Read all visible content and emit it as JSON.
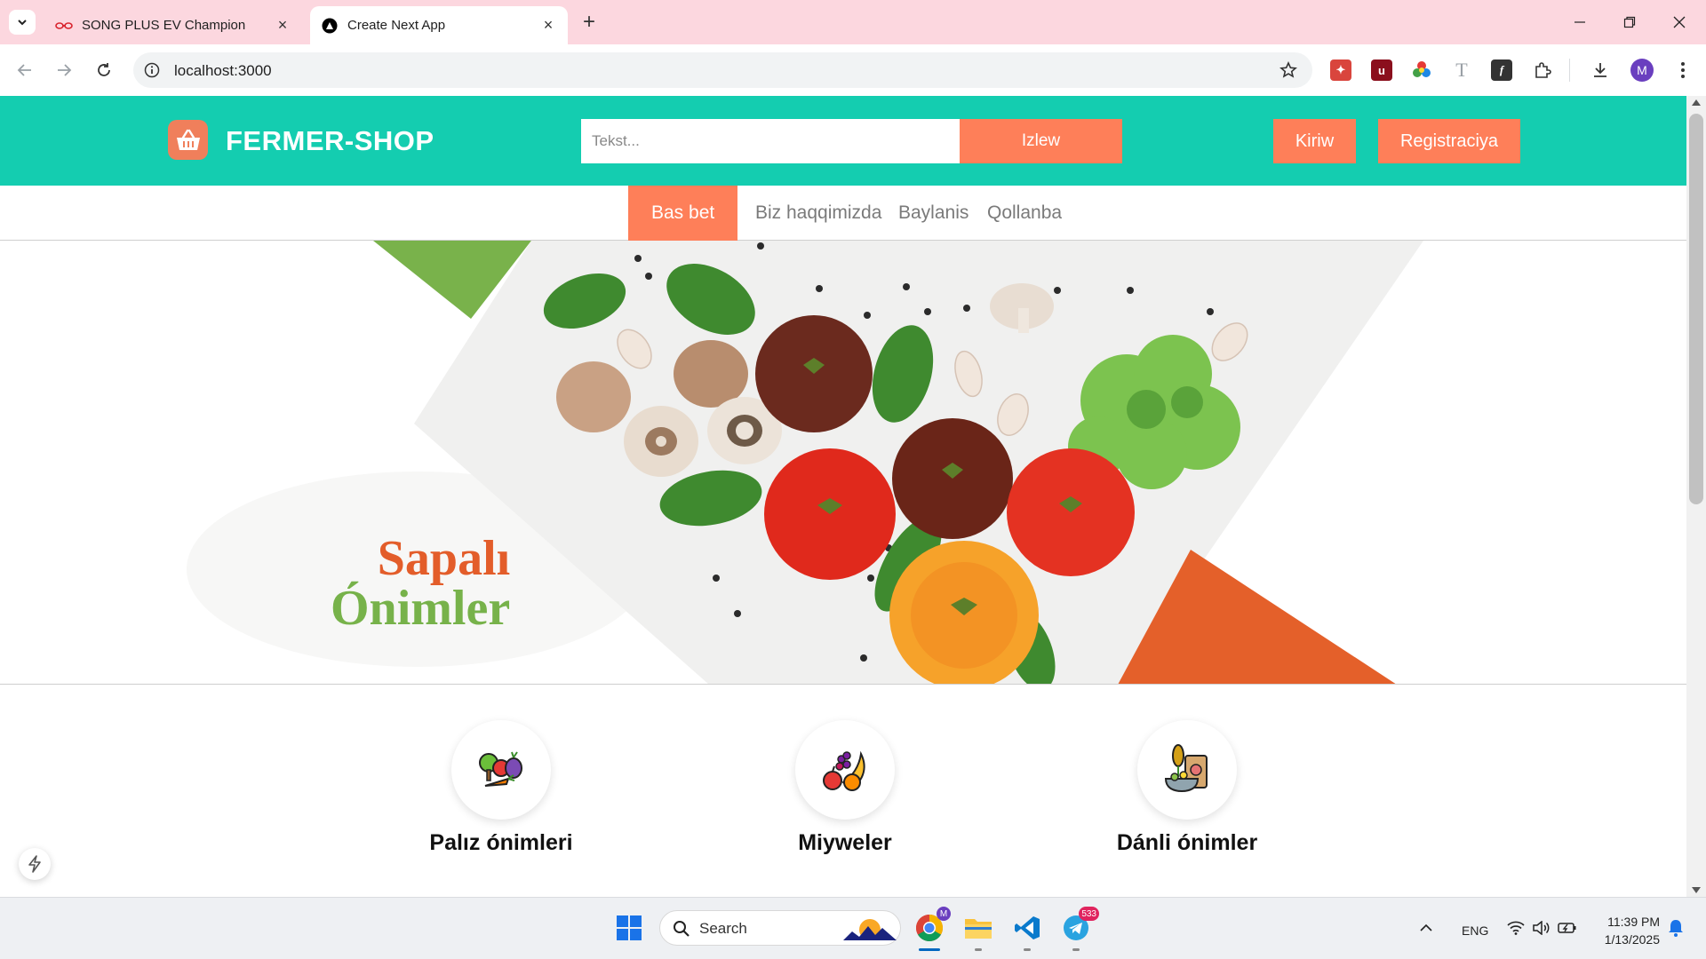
{
  "browser": {
    "tabs": [
      {
        "title": "SONG PLUS EV Champion",
        "favicon": "byd-logo-icon",
        "active": false
      },
      {
        "title": "Create Next App",
        "favicon": "nextjs-logo-icon",
        "active": true
      }
    ],
    "url": "localhost:3000"
  },
  "site": {
    "logo_text": "FERMER-SHOP",
    "search_placeholder": "Tekst...",
    "search_button": "Izlew",
    "login_button": "Kiriw",
    "register_button": "Registraciya",
    "accent_color": "#fe7f59",
    "header_color": "#14cdb0",
    "nav": [
      {
        "label": "Bas bet",
        "active": true
      },
      {
        "label": "Biz haqqimizda",
        "active": false
      },
      {
        "label": "Baylanis",
        "active": false
      },
      {
        "label": "Qollanba",
        "active": false
      }
    ],
    "hero": {
      "title_line1": "Sapalı",
      "title_line2": "Ónimler"
    },
    "categories": [
      {
        "label": "Palız ónimleri",
        "icon": "vegetables-icon"
      },
      {
        "label": "Miyweler",
        "icon": "fruits-icon"
      },
      {
        "label": "Dánli ónimler",
        "icon": "grains-icon"
      }
    ]
  },
  "taskbar": {
    "search_label": "Search",
    "telegram_badge": "533",
    "language": "ENG",
    "time": "11:39 PM",
    "date": "1/13/2025"
  }
}
